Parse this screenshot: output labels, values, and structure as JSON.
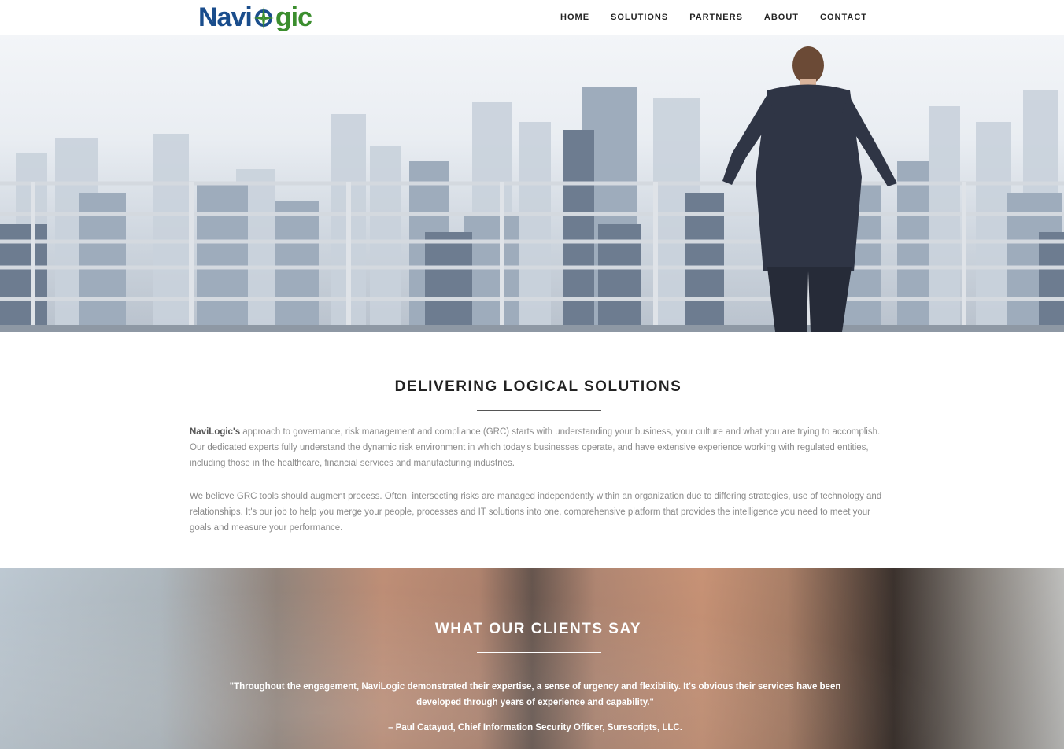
{
  "header": {
    "logo": {
      "part1": "Navi",
      "part2": "gic",
      "alt": "NaviLogic"
    },
    "nav": [
      "HOME",
      "SOLUTIONS",
      "PARTNERS",
      "ABOUT",
      "CONTACT"
    ]
  },
  "intro": {
    "title": "DELIVERING LOGICAL SOLUTIONS",
    "para1_bold": "NaviLogic's",
    "para1_rest": " approach to governance, risk management and compliance (GRC) starts with understanding your business, your culture and what you are trying to accomplish. Our dedicated experts fully understand the dynamic risk environment in which today's businesses operate, and have extensive experience working with regulated entities, including those in the healthcare, financial services and manufacturing industries.",
    "para2": "We believe GRC tools should augment process. Often, intersecting risks are managed independently within an organization due to differing strategies, use of technology and relationships. It's our job to help you merge your people, processes and IT solutions into one, comprehensive platform that provides the intelligence you need to meet your goals and measure your performance."
  },
  "testimonials": {
    "title": "WHAT OUR CLIENTS SAY",
    "quote": "\"Throughout the engagement, NaviLogic demonstrated their expertise, a sense of urgency and flexibility. It's obvious their services have been developed through years of experience and capability.\"",
    "author": "– Paul Catayud, Chief Information Security Officer, Surescripts, LLC."
  },
  "colors": {
    "logo_blue": "#1a4d8c",
    "logo_green": "#3b8e2e",
    "text_gray": "#8a8a8a",
    "heading": "#222222"
  }
}
